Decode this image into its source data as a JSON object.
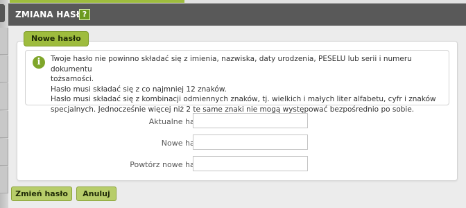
{
  "window": {
    "title": "ZMIANA HASŁA",
    "help_label": "?"
  },
  "fieldset": {
    "legend": "Nowe hasło"
  },
  "info": {
    "icon": "info-icon",
    "line1": "Twoje hasło nie powinno składać się z imienia, nazwiska, daty urodzenia, PESELU lub serii i numeru dokumentu",
    "line2": "tożsamości.",
    "line3": "Hasło musi składać się z co najmniej 12 znaków.",
    "line4": "Hasło musi składać się z kombinacji odmiennych znaków, tj. wielkich i małych liter alfabetu, cyfr i znaków",
    "line5": "specjalnych. Jednocześnie więcej niż 2 te same znaki nie mogą występować bezpośrednio po sobie."
  },
  "form": {
    "current_label": "Aktualne hasło:",
    "current_value": "",
    "new_label": "Nowe hasło:",
    "new_value": "",
    "repeat_label": "Powtórz nowe hasło:",
    "repeat_value": ""
  },
  "actions": {
    "submit_label": "Zmień hasło",
    "cancel_label": "Anuluj"
  },
  "colors": {
    "accent_green": "#9ebc3e",
    "title_bar": "#595959"
  }
}
